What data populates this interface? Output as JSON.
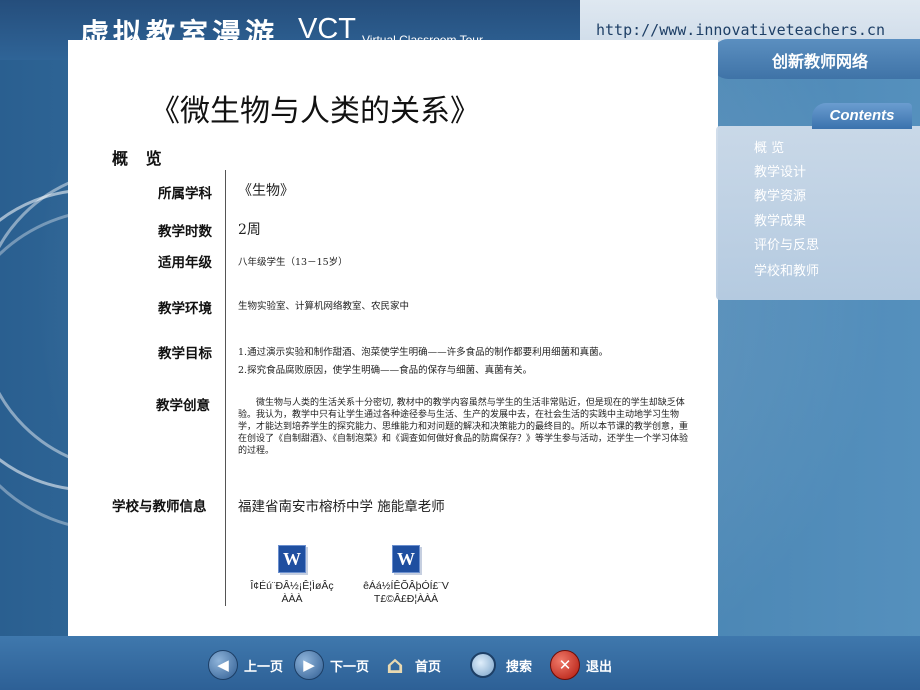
{
  "header": {
    "title_cn": "虚拟教室漫游",
    "title_abbr": "VCT",
    "title_en": "Virtual Classroom Tour",
    "url": "http://www.innovativeteachers.cn",
    "network": "创新教师网络"
  },
  "sidebar": {
    "tab": "Contents",
    "items": [
      {
        "label": "概  览"
      },
      {
        "label": "教学设计"
      },
      {
        "label": "教学资源"
      },
      {
        "label": "教学成果"
      },
      {
        "label": "评价与反思"
      },
      {
        "label": "学校和教师"
      }
    ]
  },
  "main": {
    "title": "《微生物与人类的关系》",
    "heading": "概  览",
    "rows": [
      {
        "label": "所属学科",
        "value": "《生物》"
      },
      {
        "label": "教学时数",
        "value": "2周"
      },
      {
        "label": "适用年级",
        "value": "八年级学生（13－15岁）"
      },
      {
        "label": "教学环境",
        "value": "生物实验室、计算机网络教室、农民家中"
      },
      {
        "label": "教学目标",
        "value1": "1.通过演示实验和制作甜酒、泡菜使学生明确——许多食品的制作都要利用细菌和真菌。",
        "value2": "2.探究食品腐败原因，使学生明确——食品的保存与细菌、真菌有关。"
      },
      {
        "label": "教学创意",
        "value": "微生物与人类的生活关系十分密切, 教材中的教学内容虽然与学生的生活非常贴近，但是现在的学生却缺乏体验。我认为，教学中只有让学生通过各种途径参与生活、生产的发展中去，在社会生活的实践中主动地学习生物学，才能达到培养学生的探究能力、思维能力和对问题的解决和决策能力的最终目的。所以本节课的教学创意，重在创设了《自制甜酒》、《自制泡菜》和《调查如何做好食品的防腐保存？》等学生参与活动，还学生一个学习体验的过程。"
      },
      {
        "label": "学校与教师信息",
        "value": "福建省南安市榕桥中学 施能章老师"
      }
    ],
    "files": [
      {
        "name_line1": "Î¢Éú¨ÐÂ½¡Ê¦ÌøÂç",
        "name_line2": "ÀÀÀ"
      },
      {
        "name_line1": "êÁá½ÍÊÕÂþÓÍ£¨V",
        "name_line2": "T£©Â£Ð¦ÀÀÀ"
      }
    ]
  },
  "footer": {
    "prev": "上一页",
    "next": "下一页",
    "home": "首页",
    "search": "搜索",
    "exit": "退出"
  },
  "colors": {
    "accent": "#3d79a8",
    "header": "#254e7c",
    "panel": "#ffffff"
  },
  "icons": [
    "arrow-left-icon",
    "arrow-right-icon",
    "home-icon",
    "magnifier-icon",
    "close-icon",
    "word-doc-icon"
  ]
}
